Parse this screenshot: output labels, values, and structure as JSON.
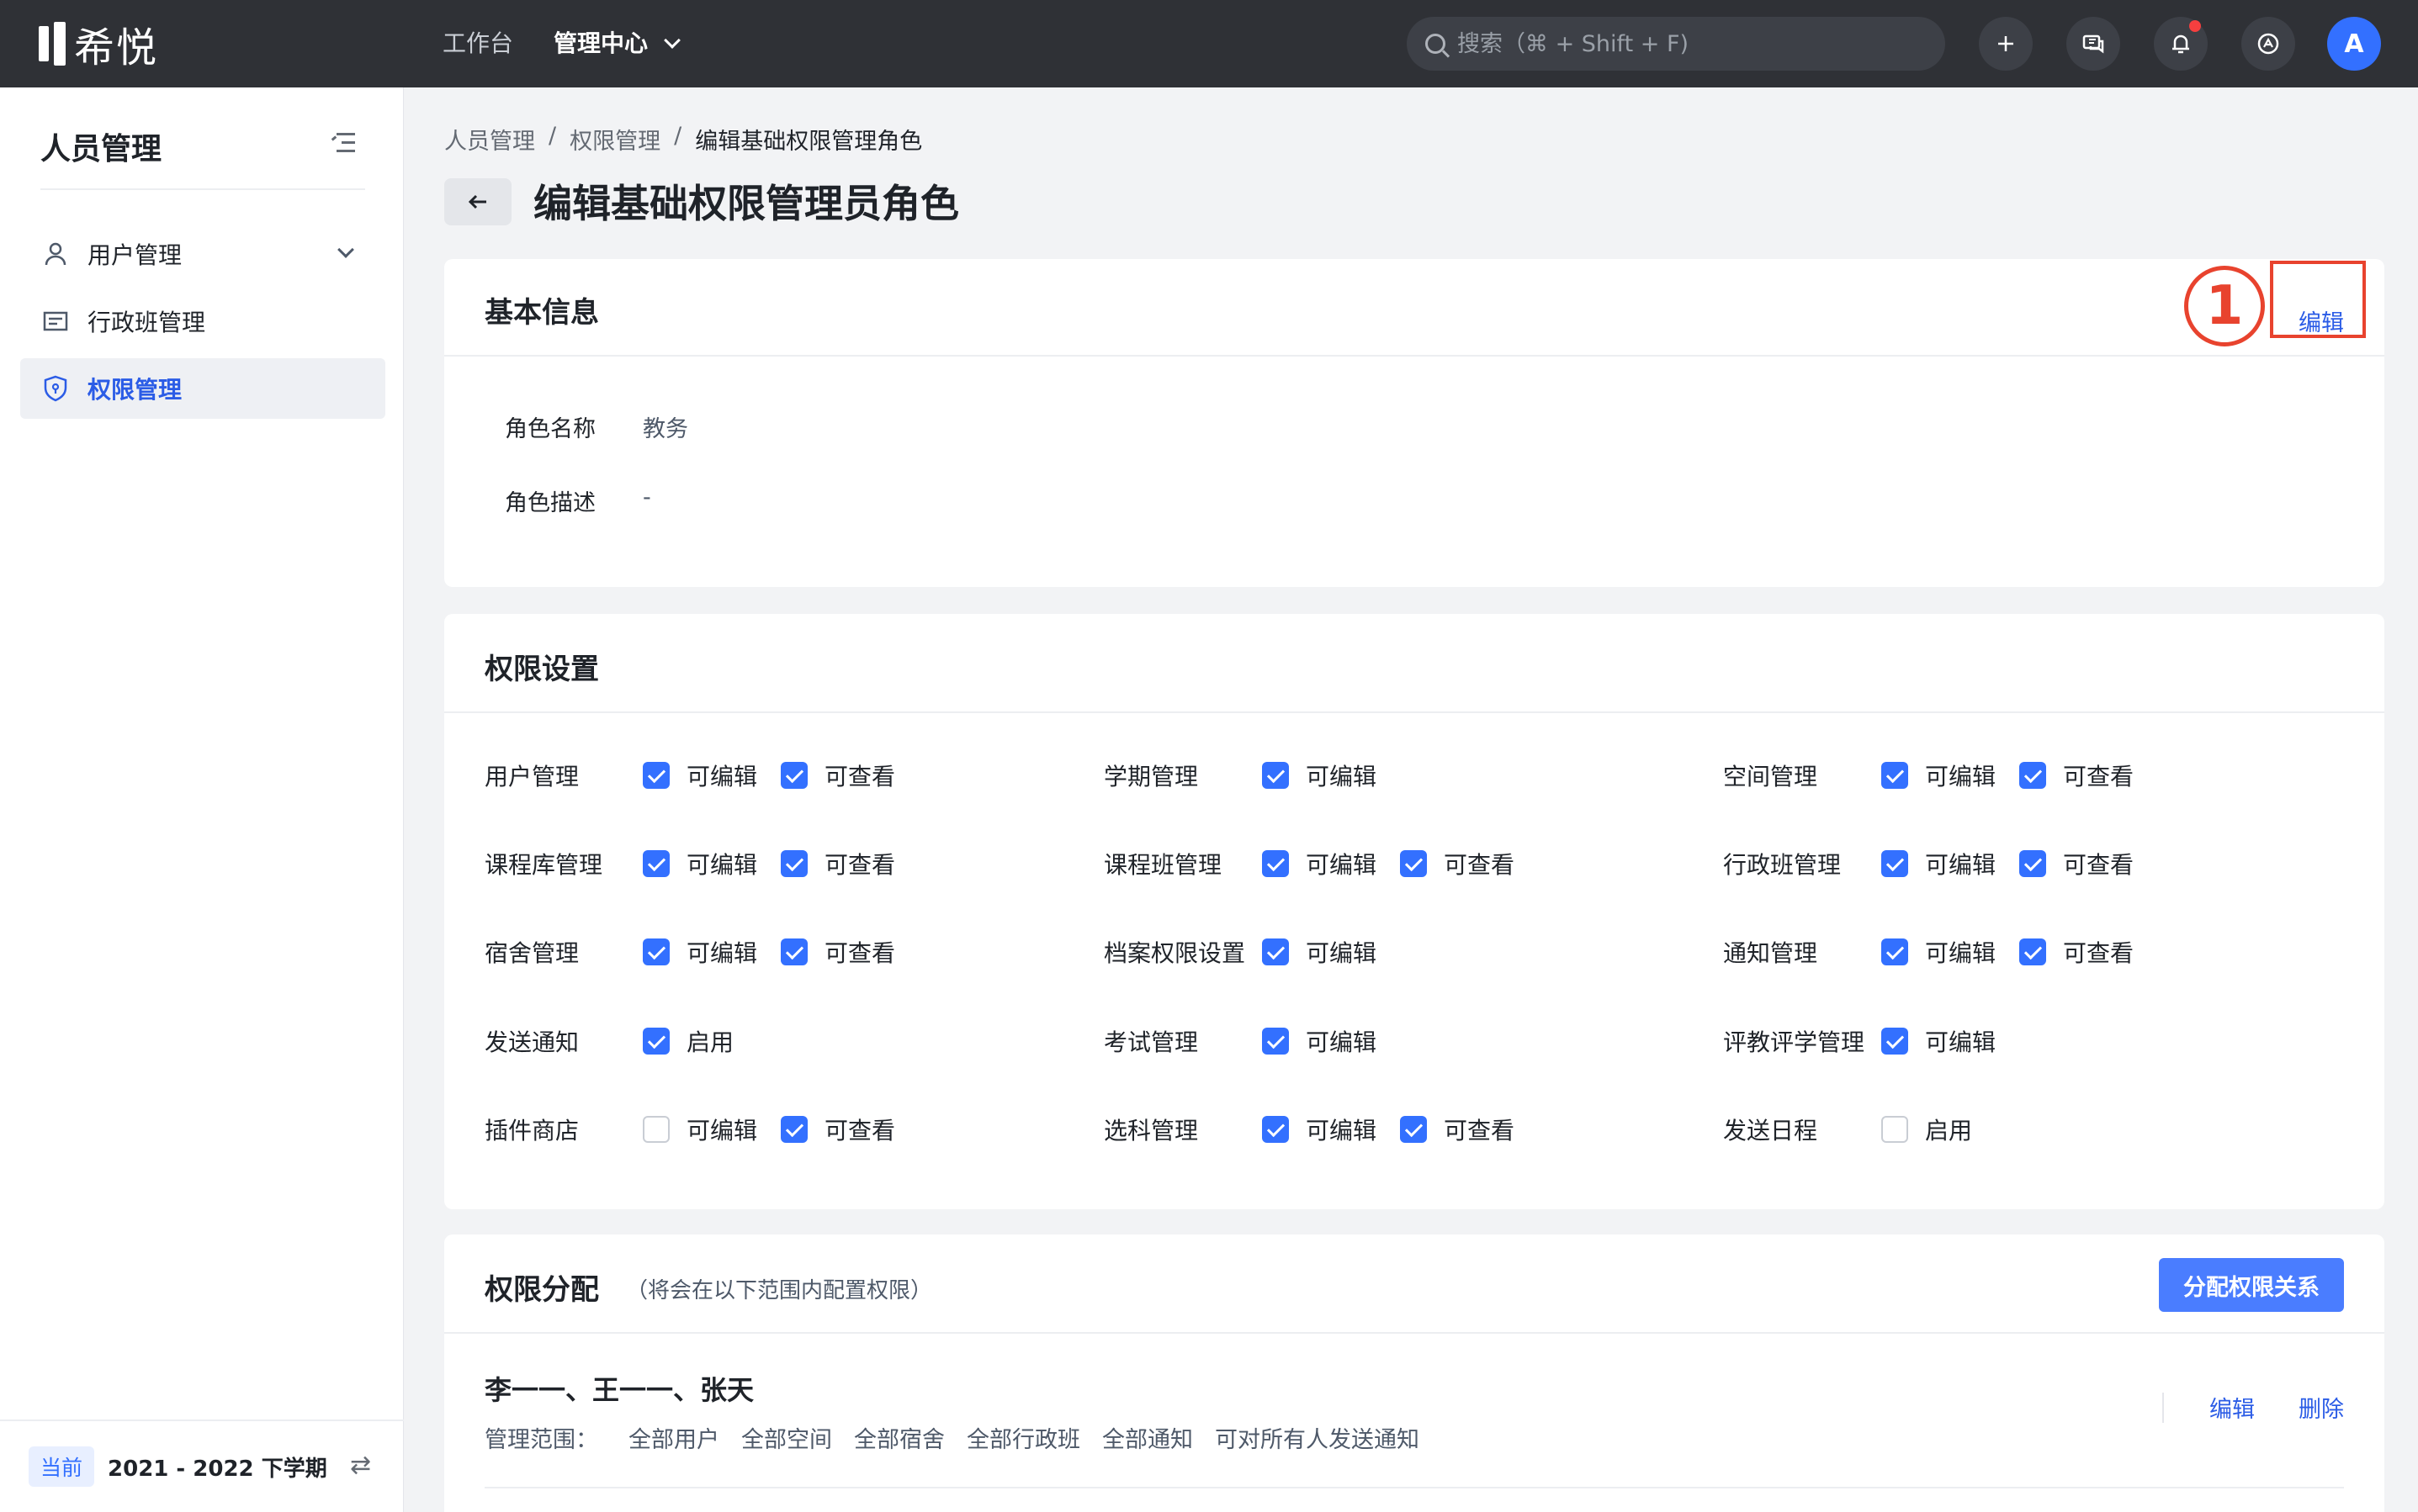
{
  "topbar": {
    "logo_text": "希悦",
    "nav": [
      {
        "label": "工作台"
      },
      {
        "label": "管理中心"
      }
    ],
    "search_placeholder": "搜索（⌘ + Shift + F)",
    "icons": [
      "plus-icon",
      "message-icon",
      "bell-icon",
      "help-icon"
    ],
    "avatar_letter": "A"
  },
  "sidebar": {
    "title": "人员管理",
    "items": [
      {
        "label": "用户管理",
        "icon": "user-icon"
      },
      {
        "label": "行政班管理",
        "icon": "class-icon"
      },
      {
        "label": "权限管理",
        "icon": "shield-icon"
      }
    ],
    "term_tag": "当前",
    "term_text": "2021 - 2022 下学期"
  },
  "breadcrumb": [
    "人员管理",
    "权限管理",
    "编辑基础权限管理角色"
  ],
  "breadcrumb_sep": "/",
  "page_title": "编辑基础权限管理员角色",
  "basic_info": {
    "title": "基本信息",
    "edit_label": "编辑",
    "annotation": "1",
    "fields": [
      {
        "label": "角色名称",
        "value": "教务"
      },
      {
        "label": "角色描述",
        "value": "-"
      }
    ]
  },
  "perm_settings": {
    "title": "权限设置",
    "columns": [
      [
        {
          "name": "用户管理",
          "opts": [
            {
              "label": "可编辑",
              "checked": true
            },
            {
              "label": "可查看",
              "checked": true
            }
          ]
        },
        {
          "name": "课程库管理",
          "opts": [
            {
              "label": "可编辑",
              "checked": true
            },
            {
              "label": "可查看",
              "checked": true
            }
          ]
        },
        {
          "name": "宿舍管理",
          "opts": [
            {
              "label": "可编辑",
              "checked": true
            },
            {
              "label": "可查看",
              "checked": true
            }
          ]
        },
        {
          "name": "发送通知",
          "opts": [
            {
              "label": "启用",
              "checked": true
            }
          ]
        },
        {
          "name": "插件商店",
          "opts": [
            {
              "label": "可编辑",
              "checked": false
            },
            {
              "label": "可查看",
              "checked": true
            }
          ]
        }
      ],
      [
        {
          "name": "学期管理",
          "opts": [
            {
              "label": "可编辑",
              "checked": true
            }
          ]
        },
        {
          "name": "课程班管理",
          "opts": [
            {
              "label": "可编辑",
              "checked": true
            },
            {
              "label": "可查看",
              "checked": true
            }
          ]
        },
        {
          "name": "档案权限设置",
          "opts": [
            {
              "label": "可编辑",
              "checked": true
            }
          ]
        },
        {
          "name": "考试管理",
          "opts": [
            {
              "label": "可编辑",
              "checked": true
            }
          ]
        },
        {
          "name": "选科管理",
          "opts": [
            {
              "label": "可编辑",
              "checked": true
            },
            {
              "label": "可查看",
              "checked": true
            }
          ]
        }
      ],
      [
        {
          "name": "空间管理",
          "opts": [
            {
              "label": "可编辑",
              "checked": true
            },
            {
              "label": "可查看",
              "checked": true
            }
          ]
        },
        {
          "name": "行政班管理",
          "opts": [
            {
              "label": "可编辑",
              "checked": true
            },
            {
              "label": "可查看",
              "checked": true
            }
          ]
        },
        {
          "name": "通知管理",
          "opts": [
            {
              "label": "可编辑",
              "checked": true
            },
            {
              "label": "可查看",
              "checked": true
            }
          ]
        },
        {
          "name": "评教评学管理",
          "opts": [
            {
              "label": "可编辑",
              "checked": true
            }
          ]
        },
        {
          "name": "发送日程",
          "opts": [
            {
              "label": "启用",
              "checked": false
            }
          ]
        }
      ]
    ]
  },
  "assignment": {
    "title": "权限分配",
    "subtitle": "（将会在以下范围内配置权限）",
    "button": "分配权限关系",
    "names": "李一一、王一一、张天",
    "scope_label": "管理范围：",
    "scopes": [
      "全部用户",
      "全部空间",
      "全部宿舍",
      "全部行政班",
      "全部通知",
      "可对所有人发送通知"
    ],
    "edit_label": "编辑",
    "delete_label": "删除"
  }
}
